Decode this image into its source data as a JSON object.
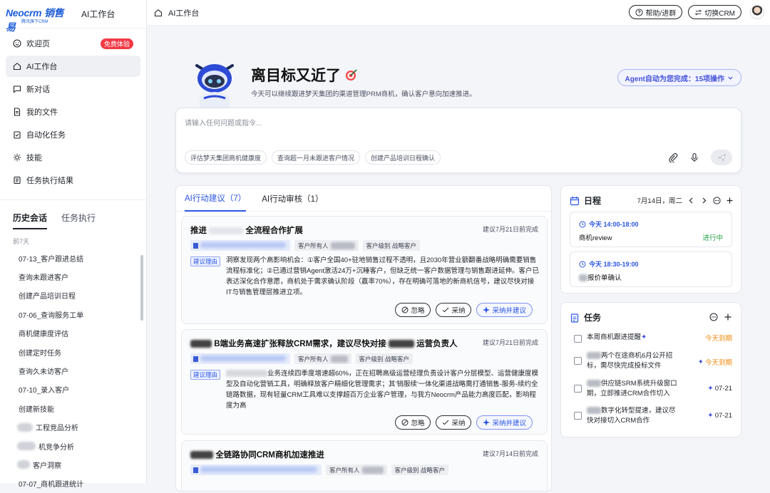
{
  "brand": {
    "logo_text": "Neocrm 销售易",
    "logo_sub": "腾讯旗下CRM",
    "app_title": "AI工作台"
  },
  "sidebar": {
    "items": [
      {
        "label": "欢迎页",
        "icon": "smile-icon",
        "badge": "免费体验"
      },
      {
        "label": "AI工作台",
        "icon": "home-icon",
        "active": true
      },
      {
        "label": "新对话",
        "icon": "new-chat-icon"
      },
      {
        "label": "我的文件",
        "icon": "file-icon"
      },
      {
        "label": "自动化任务",
        "icon": "clipboard-icon"
      },
      {
        "label": "技能",
        "icon": "sun-icon"
      },
      {
        "label": "任务执行结果",
        "icon": "list-icon"
      }
    ],
    "history_tabs": [
      "历史会话",
      "任务执行"
    ],
    "history_group": "前7天",
    "history": [
      "07-13_客户跟进总结",
      "查询未跟进客户",
      "创建产品培训日程",
      "07-06_查询服务工单",
      "商机健康度评估",
      "创建定时任务",
      "查询久未访客户",
      "07-10_录入客户",
      "创建新技能",
      "工程竞品分析",
      "机竞争分析",
      "客户洞察",
      "07-07_商机跟进统计"
    ]
  },
  "topbar": {
    "breadcrumb": "AI工作台",
    "help": "帮助/进群",
    "switch": "切换CRM"
  },
  "hero": {
    "title": "离目标又近了",
    "subtitle": "今天可以继续跟进梦天集团的渠道管理PRM商机，确认客户意向加速推进。",
    "agent_pill": "Agent自动为您完成：15项操作"
  },
  "input": {
    "placeholder": "请输入任何问题或指令...",
    "suggestions": [
      "评估梦天集团商机健康度",
      "查询超一月未跟进客户情况",
      "创建产品培训日程确认"
    ]
  },
  "suggest_panel": {
    "tabs": [
      "AI行动建议（7）",
      "AI行动审核（1）"
    ],
    "cards": [
      {
        "title_prefix": "推进",
        "title_suffix": "全流程合作扩展",
        "deadline": "建议7月21日前完成",
        "owner_tag": "客户所有人",
        "level_tag": "客户级别 战略客户",
        "reason_label": "建议理由",
        "reason": "洞察发现两个高影响机会：①客户全国40+驻地销售过程不透明，且2030年营业额翻番战略明确需要销售流程标准化；②已通过营销Agent激活24万+沉睡客户，但缺乏统一客户数据管理与销售跟进延伸。客户已表达深化合作意愿，商机处于需求确认阶段（赢率70%），存在明确可落地的新商机信号，建议尽快对接IT与销售管理层推进立项。",
        "buttons": [
          "忽略",
          "采纳",
          "采纳并建议"
        ]
      },
      {
        "title_prefix": "B端业务高速扩张释放CRM需求，建议尽快对接",
        "title_suffix": "运营负责人",
        "deadline": "建议7月21日前完成",
        "owner_tag": "客户所有人",
        "level_tag": "客户级别 战略客户",
        "reason_label": "建议理由",
        "reason": "业务连续四季度增速超60%，正在招聘高级运营经理负责设计客户分层模型、运营健康度模型及自动化营销工具，明确释放客户精细化管理需求；其'销服续'一体化渠道战略需打通销售-服务-续约全链路数据，现有轻量CRM工具难以支撑超百万企业客户管理，与我方Neocrm产品能力高度匹配，影响程度为高",
        "buttons": [
          "忽略",
          "采纳",
          "采纳并建议"
        ]
      },
      {
        "title_prefix": "",
        "title_suffix": "全链路协同CRM商机加速推进",
        "deadline": "建议7月14日前完成",
        "owner_tag": "客户所有人",
        "level_tag": "客户级别 战略客户"
      }
    ]
  },
  "calendar": {
    "title": "日程",
    "date": "7月14日，周二",
    "events": [
      {
        "time": "今天 14:00-18:00",
        "name": "商机review",
        "status": "进行中"
      },
      {
        "time": "今天 18:30-19:00",
        "name": "报价单确认",
        "status": ""
      }
    ]
  },
  "tasks": {
    "title": "任务",
    "items": [
      {
        "text": "本周商机跟进提醒",
        "due": "今天到期",
        "due_type": "red"
      },
      {
        "text": "两个在途商机6月公开招标，需尽快完成投标文件",
        "due": "今天到期",
        "due_type": "red"
      },
      {
        "text": "供应链SRM系统升级窗口期，立即推进CRM合作切入",
        "due": "07-21",
        "due_type": "blue"
      },
      {
        "text": "数字化转型提速，建议尽快对接切入CRM合作",
        "due": "07-21",
        "due_type": "blue"
      }
    ]
  },
  "colors": {
    "accent": "#2a55e5",
    "danger": "#f03a45",
    "success": "#27a54b",
    "warning": "#f0890c"
  }
}
